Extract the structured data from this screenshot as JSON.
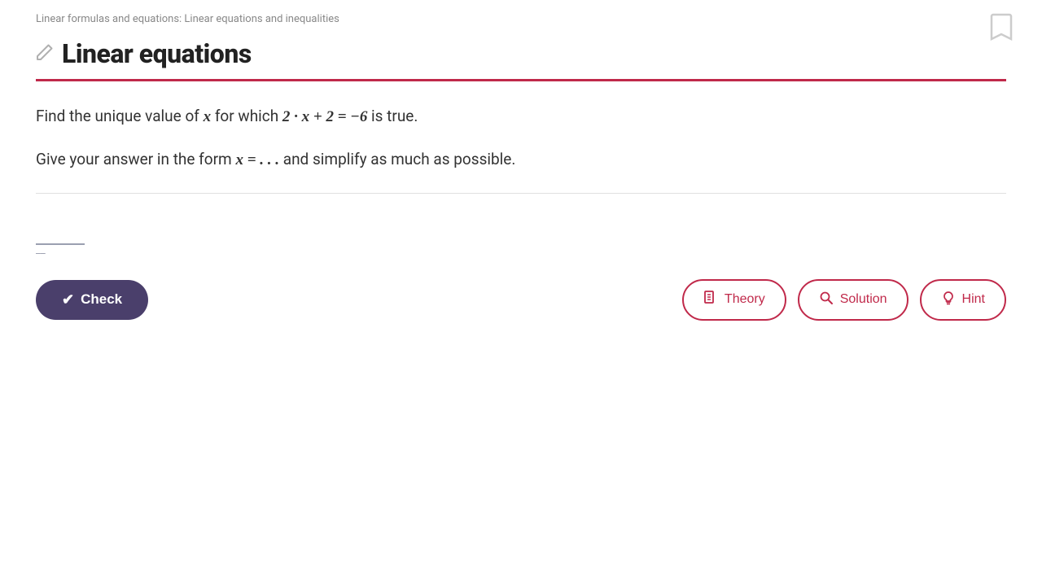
{
  "breadcrumb": {
    "text": "Linear formulas and equations: Linear equations and inequalities"
  },
  "page": {
    "title": "Linear equations"
  },
  "problem": {
    "line1_prefix": "Find the unique value of ",
    "line1_var": "x",
    "line1_middle": " for which ",
    "line1_equation": "2 · x + 2 = −6",
    "line1_suffix": " is true.",
    "line2_prefix": "Give your answer in the form ",
    "line2_form": "x = . . .",
    "line2_suffix": " and simplify as much as possible."
  },
  "buttons": {
    "check": "Check",
    "theory": "Theory",
    "solution": "Solution",
    "hint": "Hint"
  },
  "icons": {
    "pencil": "✏",
    "bookmark": "🔖",
    "check": "✔",
    "theory": "📖",
    "solution": "🔍",
    "hint": "💡"
  }
}
